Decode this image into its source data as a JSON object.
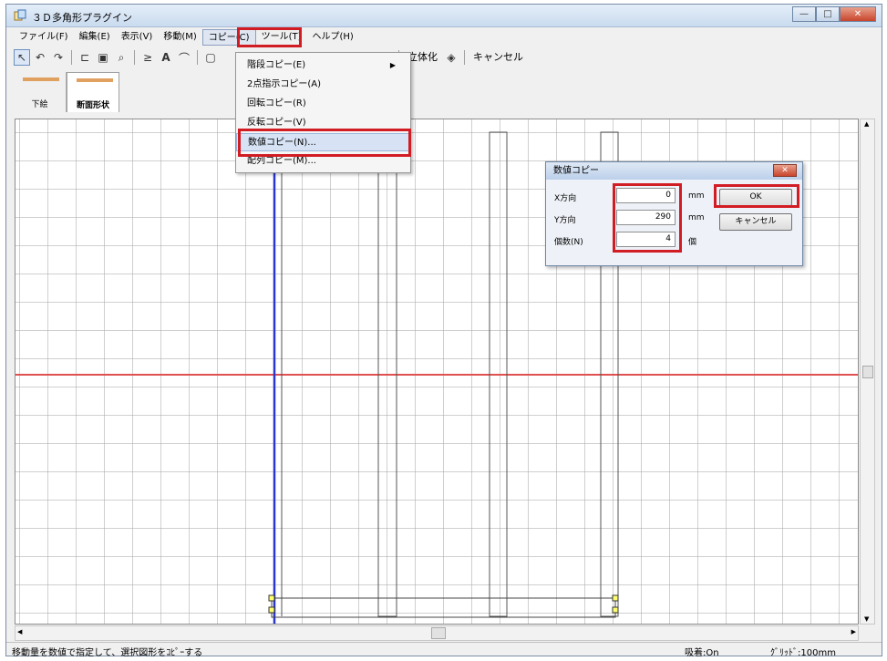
{
  "window": {
    "title": "３Ｄ多角形プラグイン",
    "min": "—",
    "max": "□",
    "close": "✕"
  },
  "menubar": [
    "ファイル(F)",
    "編集(E)",
    "表示(V)",
    "移動(M)",
    "コピー(C)",
    "ツール(T)",
    "ヘルプ(H)"
  ],
  "toolbar": {
    "solidify": "立体化",
    "cancel": "キャンセル"
  },
  "tabs": [
    "下絵",
    "断面形状"
  ],
  "copy_menu": [
    "階段コピー(E)",
    "2点指示コピー(A)",
    "回転コピー(R)",
    "反転コピー(V)",
    "数値コピー(N)...",
    "配列コピー(M)..."
  ],
  "dialog": {
    "title": "数値コピー",
    "x_label": "X方向",
    "y_label": "Y方向",
    "count_label": "個数(N)",
    "x_value": "0",
    "y_value": "290",
    "count_value": "4",
    "unit_mm": "mm",
    "unit_count": "個",
    "ok": "OK",
    "cancel": "キャンセル"
  },
  "statusbar": {
    "message": "移動量を数値で指定して、選択図形をｺﾋﾟｰする",
    "snap": "吸着:On",
    "grid": "ｸﾞﾘｯﾄﾞ:100mm"
  },
  "colors": {
    "highlight": "#d21c24",
    "axis_horizontal": "#e05050",
    "axis_vertical": "#2a36d0",
    "tab_accent": "#e0a060"
  }
}
